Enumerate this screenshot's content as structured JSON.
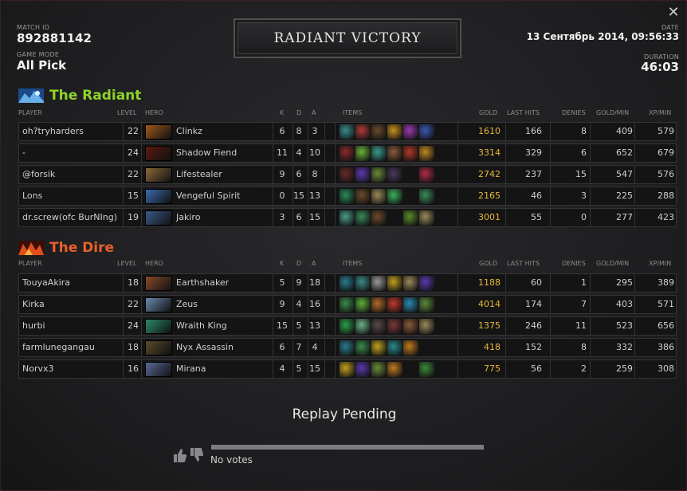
{
  "header": {
    "match_id_label": "MATCH ID",
    "match_id": "892881142",
    "game_mode_label": "GAME MODE",
    "game_mode": "All Pick",
    "title": "RADIANT VICTORY",
    "date_label": "DATE",
    "date": "13 Сентябрь 2014, 09:56:33",
    "duration_label": "DURATION",
    "duration": "46:03",
    "close_icon": "close-icon"
  },
  "columns": {
    "player": "PLAYER",
    "level": "LEVEL",
    "hero": "HERO",
    "k": "K",
    "d": "D",
    "a": "A",
    "items": "ITEMS",
    "gold": "GOLD",
    "last_hits": "LAST HITS",
    "denies": "DENIES",
    "gpm": "GOLD/MIN",
    "xpm": "XP/MIN"
  },
  "radiant": {
    "name": "The Radiant",
    "color": "#8ed42a",
    "players": [
      {
        "player": "oh?tryharders",
        "level": "22",
        "hero": "Clinkz",
        "k": "6",
        "d": "8",
        "a": "3",
        "gold": "1610",
        "last_hits": "166",
        "denies": "8",
        "gpm": "409",
        "xpm": "579",
        "hero_color": "#a0581a",
        "items": [
          "#3a8a8a",
          "#b03a3a",
          "#6a4a2a",
          "#c89020",
          "#9a3ab0",
          "#3a5ab0"
        ]
      },
      {
        "player": "-",
        "level": "24",
        "hero": "Shadow Fiend",
        "k": "11",
        "d": "4",
        "a": "10",
        "gold": "3314",
        "last_hits": "329",
        "denies": "6",
        "gpm": "652",
        "xpm": "679",
        "hero_color": "#5a1a10",
        "items": [
          "#8a2a2a",
          "#6ab03a",
          "#3a9a8a",
          "#8a5a3a",
          "#b03a2a",
          "#c08a20"
        ]
      },
      {
        "player": "@forsik",
        "level": "22",
        "hero": "Lifestealer",
        "k": "9",
        "d": "6",
        "a": "8",
        "gold": "2742",
        "last_hits": "237",
        "denies": "15",
        "gpm": "547",
        "xpm": "576",
        "hero_color": "#8a6a3a",
        "items": [
          "#6a2a2a",
          "#5a3ab0",
          "#6a8a3a",
          "#4a3a5a",
          "",
          "#b02a4a"
        ]
      },
      {
        "player": "Lons",
        "level": "15",
        "hero": "Vengeful Spirit",
        "k": "0",
        "d": "15",
        "a": "13",
        "gold": "2165",
        "last_hits": "46",
        "denies": "3",
        "gpm": "225",
        "xpm": "288",
        "hero_color": "#3a6ab0",
        "items": [
          "#2a8a5a",
          "#6a4a2a",
          "#9a8a5a",
          "#3ab05a",
          "",
          "#3a8a5a"
        ]
      },
      {
        "player": "dr.screw(ofc BurNIng)",
        "level": "19",
        "hero": "Jakiro",
        "k": "3",
        "d": "6",
        "a": "15",
        "gold": "3001",
        "last_hits": "55",
        "denies": "0",
        "gpm": "277",
        "xpm": "423",
        "hero_color": "#3a5a8a",
        "items": [
          "#4a9a8a",
          "#3a8a5a",
          "#6a4a2a",
          "",
          "#5a8a2a",
          "#9a8a5a"
        ]
      }
    ]
  },
  "dire": {
    "name": "The Dire",
    "color": "#e8602a",
    "players": [
      {
        "player": "TouyaAkira",
        "level": "18",
        "hero": "Earthshaker",
        "k": "5",
        "d": "9",
        "a": "18",
        "gold": "1188",
        "last_hits": "60",
        "denies": "1",
        "gpm": "295",
        "xpm": "389",
        "hero_color": "#8a4a2a",
        "items": [
          "#2a7a8a",
          "#3a8a8a",
          "#9a9a9a",
          "#c0a020",
          "#9a8a5a",
          "#5a3ab0"
        ]
      },
      {
        "player": "Kirka",
        "level": "22",
        "hero": "Zeus",
        "k": "9",
        "d": "4",
        "a": "16",
        "gold": "4014",
        "last_hits": "174",
        "denies": "7",
        "gpm": "403",
        "xpm": "571",
        "hero_color": "#6a8ab0",
        "items": [
          "#3a8a4a",
          "#5ab03a",
          "#b06a2a",
          "#c03a2a",
          "#2a8ab0",
          "#5a8a3a"
        ]
      },
      {
        "player": "hurbi",
        "level": "24",
        "hero": "Wraith King",
        "k": "15",
        "d": "5",
        "a": "13",
        "gold": "1375",
        "last_hits": "246",
        "denies": "11",
        "gpm": "523",
        "xpm": "656",
        "hero_color": "#2a8a6a",
        "items": [
          "#2aa04a",
          "#6ab08a",
          "#5a4a4a",
          "#7a3a3a",
          "#8a5a3a",
          "#9a8a5a"
        ]
      },
      {
        "player": "farmlunegangau",
        "level": "18",
        "hero": "Nyx Assassin",
        "k": "6",
        "d": "7",
        "a": "4",
        "gold": "418",
        "last_hits": "152",
        "denies": "8",
        "gpm": "332",
        "xpm": "386",
        "hero_color": "#5a4a2a",
        "items": [
          "#2a7a8a",
          "#3a8a4a",
          "#c0a020",
          "#2a8a8a",
          "#c07a20",
          ""
        ]
      },
      {
        "player": "Norvx3",
        "level": "16",
        "hero": "Mirana",
        "k": "4",
        "d": "5",
        "a": "15",
        "gold": "775",
        "last_hits": "56",
        "denies": "2",
        "gpm": "259",
        "xpm": "308",
        "hero_color": "#5a6a9a",
        "items": [
          "#c0a020",
          "#5a3ab0",
          "#6a8a3a",
          "#c07a20",
          "",
          "#3a8a3a"
        ]
      }
    ]
  },
  "replay_status": "Replay Pending",
  "votes": {
    "text": "No votes",
    "upvote_icon": "thumbs-up-icon",
    "downvote_icon": "thumbs-down-icon"
  }
}
